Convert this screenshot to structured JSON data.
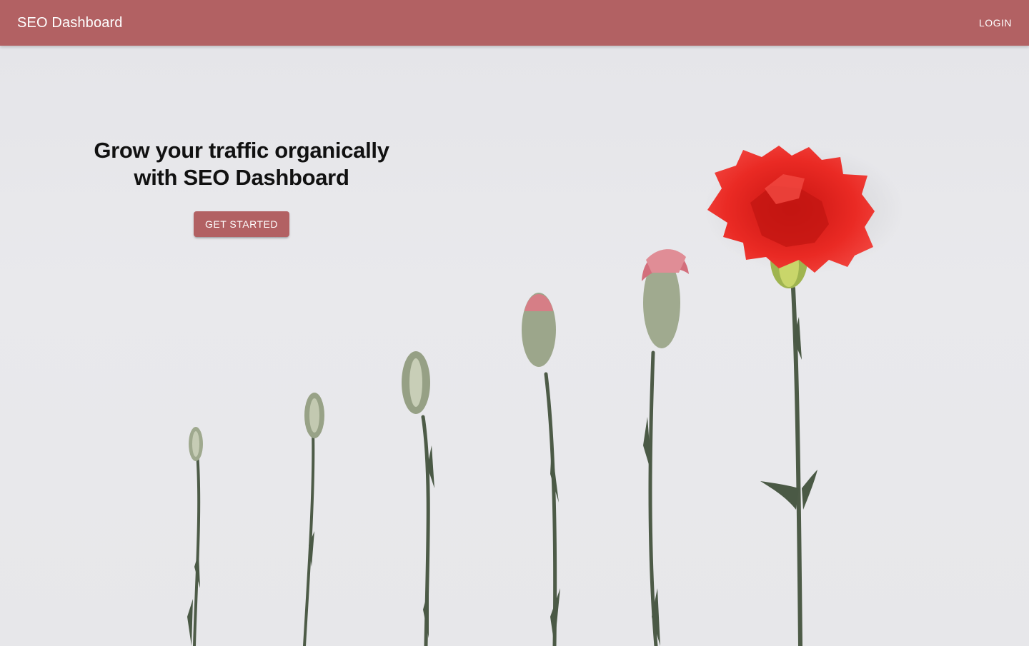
{
  "app_bar": {
    "title": "SEO Dashboard",
    "login_label": "LOGIN"
  },
  "hero": {
    "heading_line_1": "Grow your traffic organically",
    "heading_line_2": "with SEO Dashboard",
    "cta_label": "GET STARTED"
  },
  "colors": {
    "primary": "#b26163",
    "background": "#e7e7ea",
    "flower_red": "#e5221f",
    "bud_pink": "#cf6b78",
    "stem_green": "#4b5a45"
  },
  "illustration": {
    "subject": "carnation flowers growing from bud to bloom"
  }
}
